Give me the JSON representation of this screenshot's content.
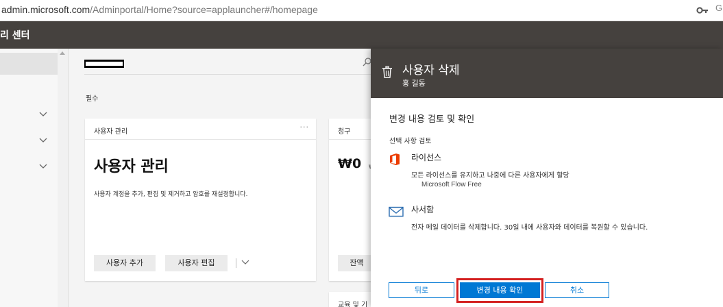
{
  "browser": {
    "url_host": "admin.microsoft.com",
    "url_rest": "/Adminportal/Home?source=applauncher#/homepage",
    "ext_letter": "G"
  },
  "app": {
    "title": "리 센터"
  },
  "main": {
    "section_label": "필수",
    "user_card": {
      "header": "사용자 관리",
      "more": "···",
      "title": "사용자 관리",
      "description": "사용자 계정을 추가, 편집 및 제거하고 암호를 재설정합니다.",
      "add_button": "사용자 추가",
      "edit_button": "사용자 편집"
    },
    "billing_card": {
      "header": "청구",
      "amount": "₩0",
      "amount_suffix": "₩",
      "button": "잔액"
    },
    "bottom_card": {
      "header": "교육 및 기"
    }
  },
  "panel": {
    "title": "사용자 삭제",
    "subtitle": "홍 길동",
    "review_title": "변경 내용 검토 및 확인",
    "review_sub": "선택 사항 검토",
    "license": {
      "title": "라이선스",
      "description": "모든 라이선스를 유지하고 나중에 다른 사용자에게 할당",
      "item": "Microsoft Flow Free"
    },
    "mailbox": {
      "title": "사서함",
      "description": "전자 메일 데이터를 삭제합니다. 30일 내에 사용자와 데이터를 복원할 수 있습니다."
    },
    "back_button": "뒤로",
    "confirm_button": "변경 내용 확인",
    "cancel_button": "취소"
  },
  "colors": {
    "header_bg": "#45413e",
    "accent": "#0078d4",
    "highlight": "#d42020",
    "office": "#eb3c00"
  }
}
